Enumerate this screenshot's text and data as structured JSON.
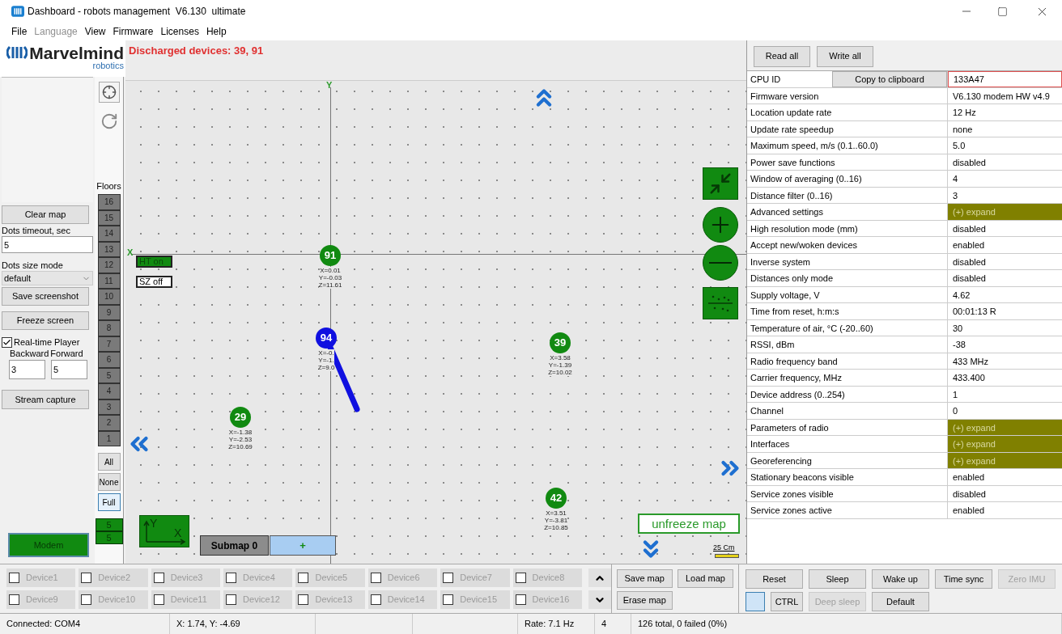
{
  "window": {
    "title": "Dashboard - robots management  V6.130  ultimate"
  },
  "menu": [
    {
      "label": "File",
      "disabled": false
    },
    {
      "label": "Language",
      "disabled": true
    },
    {
      "label": "View",
      "disabled": false
    },
    {
      "label": "Firmware",
      "disabled": false
    },
    {
      "label": "Licenses",
      "disabled": false
    },
    {
      "label": "Help",
      "disabled": false
    }
  ],
  "logo": {
    "name": "Marvelmind",
    "sub": "robotics"
  },
  "left_panel": {
    "clear_map": "Clear map",
    "dots_timeout": {
      "label": "Dots timeout, sec",
      "value": "5"
    },
    "dots_size": {
      "label": "Dots size mode",
      "value": "default"
    },
    "save_screenshot": "Save screenshot",
    "freeze_screen": "Freeze screen",
    "realtime_player": {
      "label": "Real-time Player",
      "checked": true
    },
    "backward": {
      "label": "Backward",
      "value": "3"
    },
    "forward": {
      "label": "Forward",
      "value": "5"
    },
    "stream_capture": "Stream capture",
    "modem": "Modem"
  },
  "floors": {
    "title": "Floors",
    "levels": [
      "16",
      "15",
      "14",
      "13",
      "12",
      "11",
      "10",
      "9",
      "8",
      "7",
      "6",
      "5",
      "4",
      "3",
      "2",
      "1"
    ],
    "filters": [
      {
        "label": "All",
        "selected": false
      },
      {
        "label": "None",
        "selected": false
      },
      {
        "label": "Full",
        "selected": true
      }
    ],
    "counts": [
      "5",
      "5"
    ]
  },
  "map": {
    "alert": "Discharged devices: 39, 91",
    "axes": {
      "x": "X",
      "y": "Y"
    },
    "toggles": [
      {
        "label": "HT on",
        "on": true
      },
      {
        "label": "SZ off",
        "on": false
      }
    ],
    "beacons": [
      {
        "id": "91",
        "color": "#118a11",
        "lines": [
          "X=0.01",
          "Y=-0.03",
          "Z=11.61"
        ]
      },
      {
        "id": "94",
        "color": "#1010e0",
        "lines": [
          "X=-0.",
          "Y=-1.",
          "Z=9.0"
        ]
      },
      {
        "id": "39",
        "color": "#118a11",
        "lines": [
          "X=3.58",
          "Y=-1.39",
          "Z=10.02"
        ]
      },
      {
        "id": "29",
        "color": "#118a11",
        "lines": [
          "X=-1.38",
          "Y=-2.53",
          "Z=10.69"
        ]
      },
      {
        "id": "42",
        "color": "#118a11",
        "lines": [
          "X=3.51",
          "Y=-3.81",
          "Z=10.85"
        ]
      }
    ],
    "axis_icon": {
      "y": "Y",
      "x": "X"
    },
    "submap": "Submap 0",
    "add_submap": "+",
    "unfreeze": "unfreeze map",
    "scale": "25 Cm"
  },
  "devices": [
    {
      "label": "Device1",
      "checked": false
    },
    {
      "label": "Device2",
      "checked": false
    },
    {
      "label": "Device3",
      "checked": false
    },
    {
      "label": "Device4",
      "checked": false
    },
    {
      "label": "Device5",
      "checked": false
    },
    {
      "label": "Device6",
      "checked": false
    },
    {
      "label": "Device7",
      "checked": false
    },
    {
      "label": "Device8",
      "checked": false
    },
    {
      "label": "Device9",
      "checked": false
    },
    {
      "label": "Device10",
      "checked": false
    },
    {
      "label": "Device11",
      "checked": false
    },
    {
      "label": "Device12",
      "checked": false
    },
    {
      "label": "Device13",
      "checked": false
    },
    {
      "label": "Device14",
      "checked": false
    },
    {
      "label": "Device15",
      "checked": false
    },
    {
      "label": "Device16",
      "checked": false
    }
  ],
  "map_buttons": [
    "Save map",
    "Load map",
    "Erase map"
  ],
  "table": {
    "read_all": "Read all",
    "write_all": "Write all",
    "copy": "Copy to clipboard",
    "rows": [
      {
        "name": "CPU ID",
        "value": "133A47",
        "kind": "id"
      },
      {
        "name": "Firmware version",
        "value": "V6.130 modem HW v4.9",
        "kind": "plain"
      },
      {
        "name": "Location update rate",
        "value": "12 Hz",
        "kind": "plain"
      },
      {
        "name": "Update rate speedup",
        "value": "none",
        "kind": "plain"
      },
      {
        "name": "Maximum speed, m/s (0.1..60.0)",
        "value": "5.0",
        "kind": "plain"
      },
      {
        "name": "Power save functions",
        "value": "disabled",
        "kind": "plain"
      },
      {
        "name": "Window of averaging (0..16)",
        "value": "4",
        "kind": "plain"
      },
      {
        "name": "Distance filter (0..16)",
        "value": "3",
        "kind": "plain"
      },
      {
        "name": "Advanced settings",
        "value": "(+) expand",
        "kind": "expand"
      },
      {
        "name": "High resolution mode (mm)",
        "value": "disabled",
        "kind": "plain"
      },
      {
        "name": "Accept new/woken devices",
        "value": "enabled",
        "kind": "plain"
      },
      {
        "name": "Inverse system",
        "value": "disabled",
        "kind": "plain"
      },
      {
        "name": "Distances only mode",
        "value": "disabled",
        "kind": "plain"
      },
      {
        "name": "Supply voltage, V",
        "value": "4.62",
        "kind": "plain"
      },
      {
        "name": "Time from reset, h:m:s",
        "value": "00:01:13  R",
        "kind": "plain"
      },
      {
        "name": "Temperature of air, °C (-20..60)",
        "value": "30",
        "kind": "plain"
      },
      {
        "name": "RSSI, dBm",
        "value": "-38",
        "kind": "plain"
      },
      {
        "name": "Radio frequency band",
        "value": "433 MHz",
        "kind": "plain"
      },
      {
        "name": "Carrier frequency, MHz",
        "value": "433.400",
        "kind": "plain"
      },
      {
        "name": "Device address (0..254)",
        "value": "1",
        "kind": "plain"
      },
      {
        "name": "Channel",
        "value": "0",
        "kind": "plain"
      },
      {
        "name": "Parameters of radio",
        "value": "(+) expand",
        "kind": "expand"
      },
      {
        "name": "Interfaces",
        "value": "(+) expand",
        "kind": "expand"
      },
      {
        "name": "Georeferencing",
        "value": "(+) expand",
        "kind": "expand"
      },
      {
        "name": "Stationary beacons visible",
        "value": "enabled",
        "kind": "plain"
      },
      {
        "name": "Service zones visible",
        "value": "disabled",
        "kind": "plain"
      },
      {
        "name": "Service zones active",
        "value": "enabled",
        "kind": "plain"
      }
    ]
  },
  "commands_row1": [
    {
      "label": "Reset",
      "disabled": false
    },
    {
      "label": "Sleep",
      "disabled": false
    },
    {
      "label": "Wake up",
      "disabled": false
    },
    {
      "label": "Time sync",
      "disabled": false
    },
    {
      "label": "Zero IMU",
      "disabled": true
    }
  ],
  "commands_row2": [
    {
      "label": "CTRL",
      "disabled": false
    },
    {
      "label": "Deep sleep",
      "disabled": true
    },
    {
      "label": "Default",
      "disabled": false
    }
  ],
  "status_bar": [
    "Connected: COM4",
    "X: 1.74, Y: -4.69",
    "Rate: 7.1 Hz",
    "4",
    "126 total, 0 failed (0%)"
  ]
}
